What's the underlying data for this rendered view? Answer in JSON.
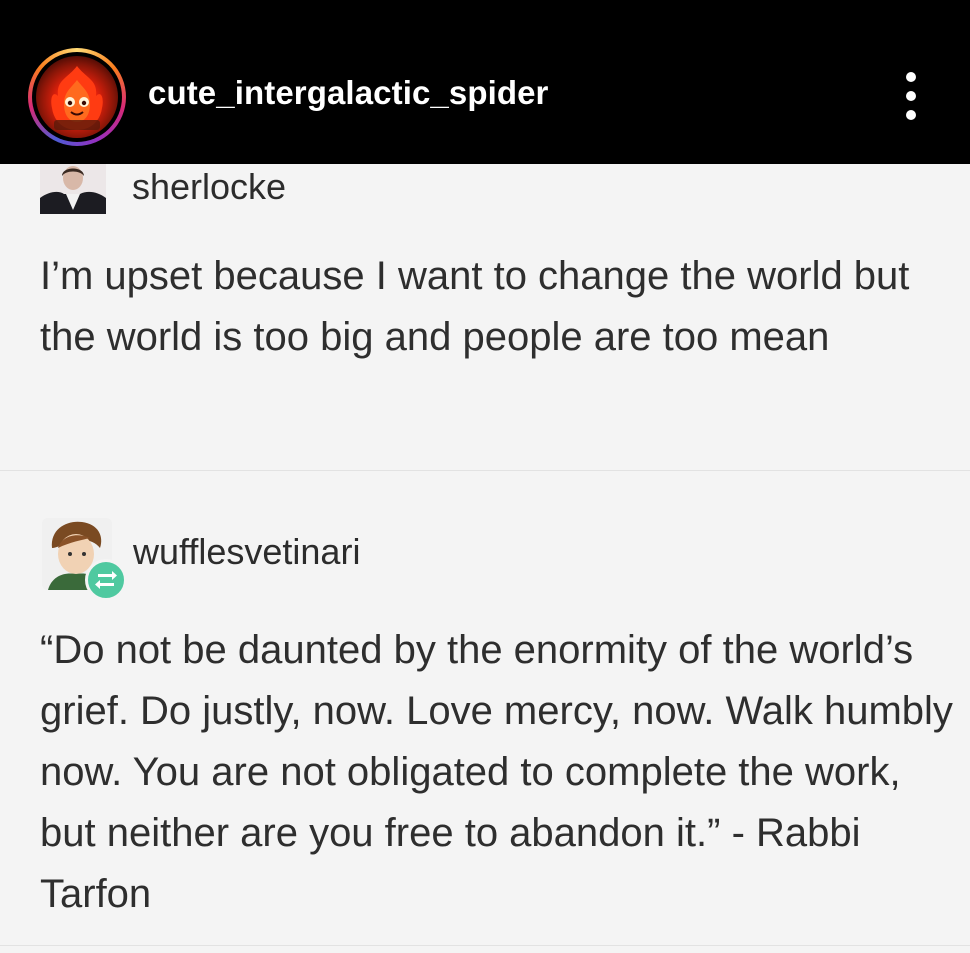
{
  "header": {
    "username": "cute_intergalactic_spider",
    "avatar_icon": "calcifer-fire-icon",
    "menu_icon": "more-vertical-icon"
  },
  "posts": [
    {
      "username": "sherlocke",
      "avatar_icon": "user-avatar-icon",
      "text": "I’m upset because I want to change the world but the world is too big and people are too mean"
    },
    {
      "username": "wufflesvetinari",
      "avatar_icon": "user-avatar-icon",
      "badge_icon": "reblog-icon",
      "text": "“Do not be daunted by the enormity of the world’s grief. Do justly, now. Love mercy, now. Walk humbly now. You are not obligated to complete the work, but neither are you free to abandon it.” - Rabbi Tarfon"
    }
  ],
  "colors": {
    "header_bg": "#000000",
    "page_bg": "#f4f4f4",
    "text": "#2e2e2e",
    "reblog_badge": "#4fc9a0"
  }
}
